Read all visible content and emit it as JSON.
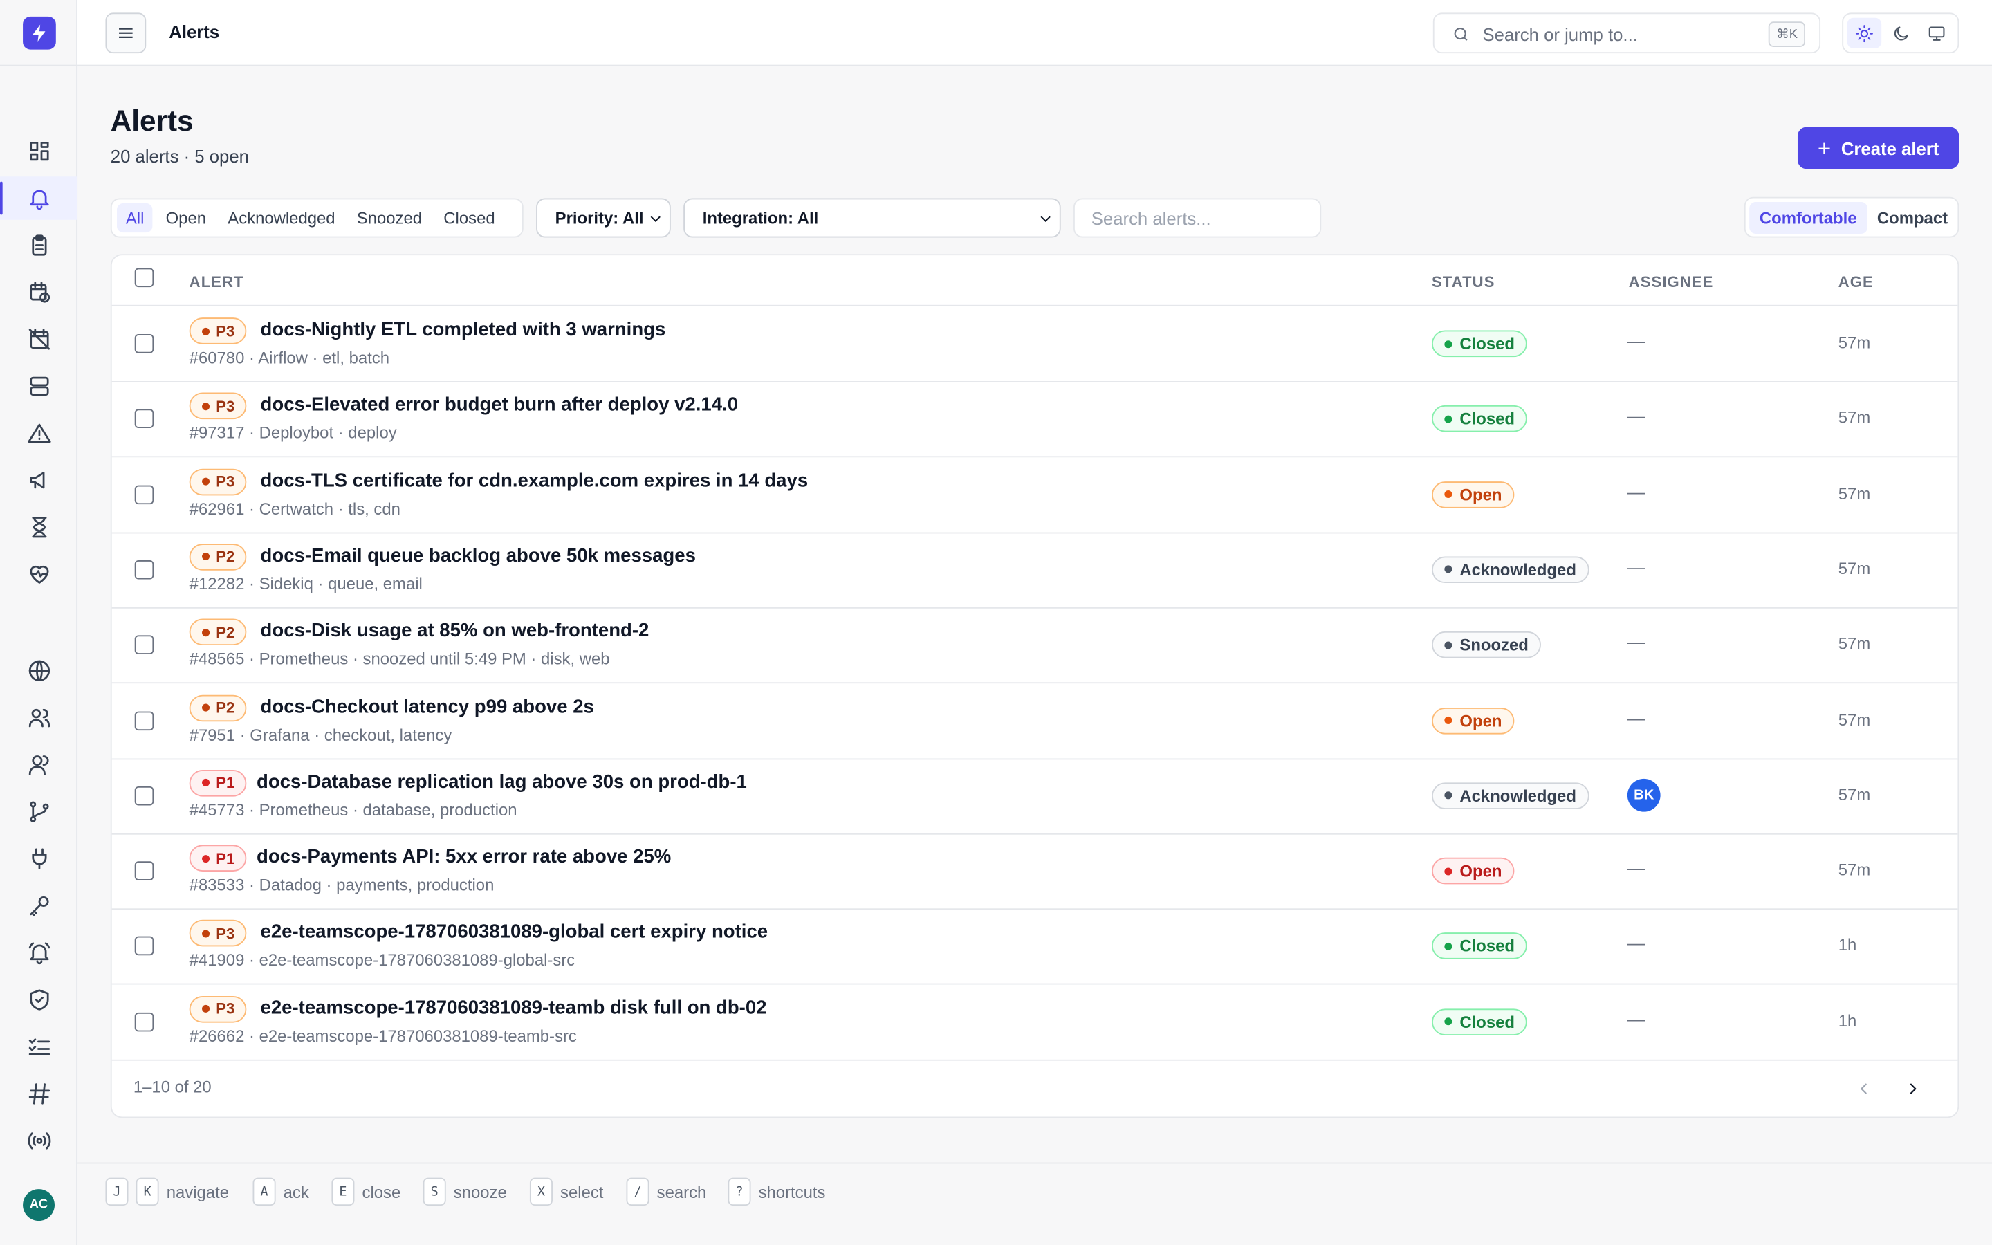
{
  "topbar": {
    "title": "Alerts",
    "search_placeholder": "Search or jump to...",
    "search_shortcut": "⌘K"
  },
  "user": {
    "initials": "AC"
  },
  "page": {
    "title": "Alerts",
    "subtitle": "20 alerts · 5 open",
    "create_label": "Create alert"
  },
  "filters": {
    "tabs": [
      "All",
      "Open",
      "Acknowledged",
      "Snoozed",
      "Closed"
    ],
    "active_tab": "All",
    "priority": "Priority: All",
    "integration": "Integration: All",
    "search_placeholder": "Search alerts...",
    "density": [
      "Comfortable",
      "Compact"
    ],
    "active_density": "Comfortable"
  },
  "table": {
    "columns": [
      "ALERT",
      "STATUS",
      "ASSIGNEE",
      "AGE"
    ],
    "rows": [
      {
        "priority": "P3",
        "title": "docs-Nightly ETL completed with 3 warnings",
        "meta": "#60780 · Airflow · etl, batch",
        "status": "Closed",
        "assignee": "—",
        "age": "57m"
      },
      {
        "priority": "P3",
        "title": "docs-Elevated error budget burn after deploy v2.14.0",
        "meta": "#97317 · Deploybot · deploy",
        "status": "Closed",
        "assignee": "—",
        "age": "57m"
      },
      {
        "priority": "P3",
        "title": "docs-TLS certificate for cdn.example.com expires in 14 days",
        "meta": "#62961 · Certwatch · tls, cdn",
        "status": "Open",
        "assignee": "—",
        "age": "57m"
      },
      {
        "priority": "P2",
        "title": "docs-Email queue backlog above 50k messages",
        "meta": "#12282 · Sidekiq · queue, email",
        "status": "Acknowledged",
        "assignee": "—",
        "age": "57m"
      },
      {
        "priority": "P2",
        "title": "docs-Disk usage at 85% on web-frontend-2",
        "meta": "#48565 · Prometheus · snoozed until 5:49 PM · disk, web",
        "status": "Snoozed",
        "assignee": "—",
        "age": "57m"
      },
      {
        "priority": "P2",
        "title": "docs-Checkout latency p99 above 2s",
        "meta": "#7951 · Grafana · checkout, latency",
        "status": "Open",
        "assignee": "—",
        "age": "57m"
      },
      {
        "priority": "P1",
        "title": "docs-Database replication lag above 30s on prod-db-1",
        "meta": "#45773 · Prometheus · database, production",
        "status": "Acknowledged",
        "assignee": "BK",
        "age": "57m"
      },
      {
        "priority": "P1",
        "title": "docs-Payments API: 5xx error rate above 25%",
        "meta": "#83533 · Datadog · payments, production",
        "status": "Open",
        "assignee": "—",
        "age": "57m"
      },
      {
        "priority": "P3",
        "title": "e2e-teamscope-1787060381089-global cert expiry notice",
        "meta": "#41909 · e2e-teamscope-1787060381089-global-src",
        "status": "Closed",
        "assignee": "—",
        "age": "1h"
      },
      {
        "priority": "P3",
        "title": "e2e-teamscope-1787060381089-teamb disk full on db-02",
        "meta": "#26662 · e2e-teamscope-1787060381089-teamb-src",
        "status": "Closed",
        "assignee": "—",
        "age": "1h"
      }
    ],
    "range": "1–10 of 20"
  },
  "shortcuts": [
    {
      "keys": [
        "J",
        "K"
      ],
      "label": "navigate"
    },
    {
      "keys": [
        "A"
      ],
      "label": "ack"
    },
    {
      "keys": [
        "E"
      ],
      "label": "close"
    },
    {
      "keys": [
        "S"
      ],
      "label": "snooze"
    },
    {
      "keys": [
        "X"
      ],
      "label": "select"
    },
    {
      "keys": [
        "/"
      ],
      "label": "search"
    },
    {
      "keys": [
        "?"
      ],
      "label": "shortcuts"
    }
  ],
  "colors": {
    "accent": "#4f46e5",
    "closed": "#15803d",
    "open": "#c2410c",
    "p1": "#b91c1c",
    "avatar_user": "#0f766e",
    "avatar_assignee": "#2563eb"
  }
}
